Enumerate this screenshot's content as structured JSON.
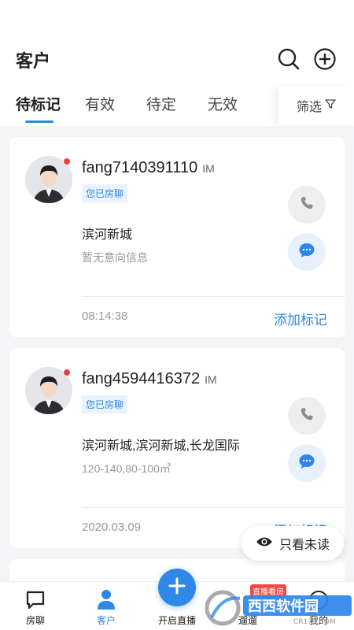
{
  "header": {
    "title": "客户",
    "search_icon": "search-icon",
    "add_icon": "add-circle-icon"
  },
  "tabs": [
    {
      "label": "待标记",
      "active": true
    },
    {
      "label": "有效",
      "active": false
    },
    {
      "label": "待定",
      "active": false
    },
    {
      "label": "无效",
      "active": false
    }
  ],
  "filter": {
    "label": "筛选",
    "icon": "filter-icon"
  },
  "customers": [
    {
      "name": "fang7140391110",
      "im_label": "IM",
      "tag": "您已房聊",
      "location": "滨河新城",
      "intent": "暂无意向信息",
      "time": "08:14:38",
      "action": "添加标记"
    },
    {
      "name": "fang4594416372",
      "im_label": "IM",
      "tag": "您已房聊",
      "location": "滨河新城,滨河新城,长龙国际",
      "intent": "120-140,80-100㎡",
      "time": "2020.03.09",
      "action": "添加标记"
    }
  ],
  "unread_filter": {
    "label": "只看未读",
    "icon": "eye-icon"
  },
  "bottom_nav": {
    "items": [
      {
        "label": "房聊",
        "icon": "chat-bubble-icon",
        "active": false
      },
      {
        "label": "客户",
        "icon": "person-icon",
        "active": true
      },
      {
        "label": "开启直播",
        "icon": "plus-icon",
        "active": false
      },
      {
        "label": "遛遛",
        "icon": "house-icon",
        "active": false
      },
      {
        "label": "我的",
        "icon": "user-icon",
        "active": false
      }
    ],
    "live_badge": "直播看房"
  },
  "watermark": {
    "text": "西西软件园",
    "subtext": "CR173.COM"
  },
  "colors": {
    "accent": "#2f87e8",
    "badge_red": "#f24a4a",
    "online_dot": "#f23b3b"
  }
}
